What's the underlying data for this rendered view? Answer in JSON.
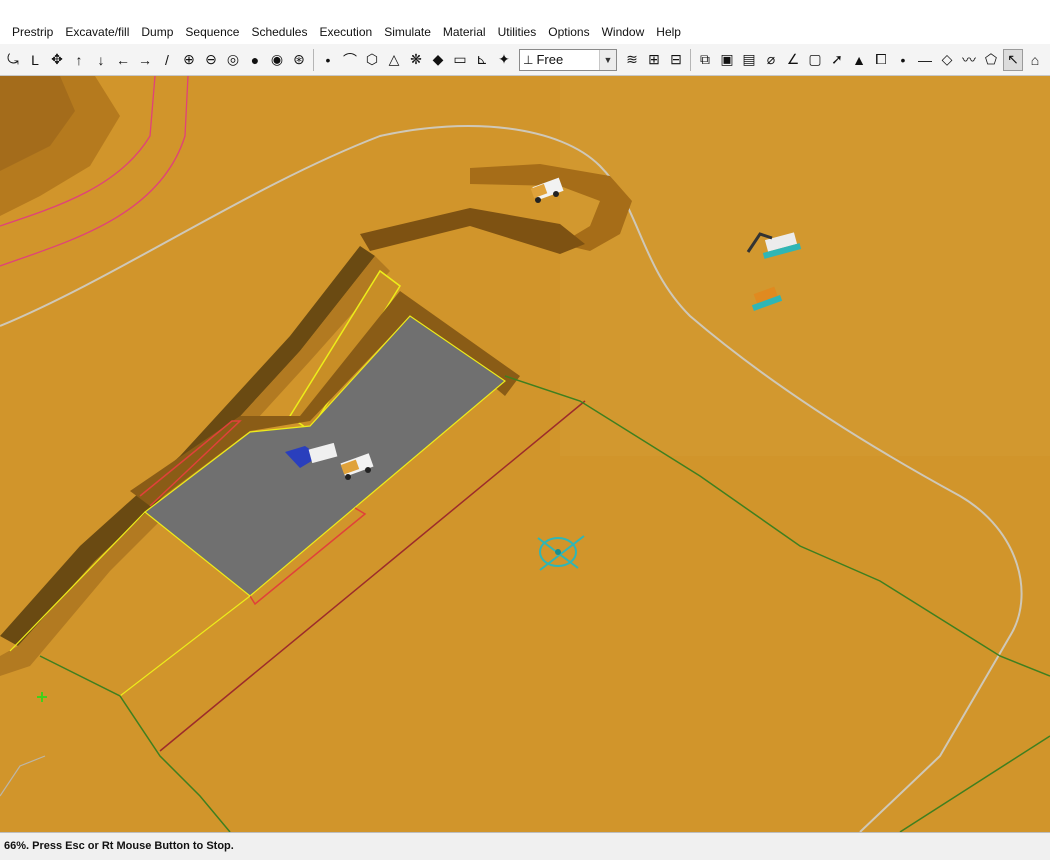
{
  "menu": [
    "Prestrip",
    "Excavate/fill",
    "Dump",
    "Sequence",
    "Schedules",
    "Execution",
    "Simulate",
    "Material",
    "Utilities",
    "Options",
    "Window",
    "Help"
  ],
  "toolbar": {
    "group1": [
      "⤿",
      "L",
      "✥",
      "↑",
      "↓",
      "←",
      "→",
      "/",
      "⊕",
      "⊖",
      "◎",
      "●",
      "◉",
      "⊛"
    ],
    "group1_names": [
      "rotate-icon",
      "axis-icon",
      "pan-icon",
      "move-up-icon",
      "move-down-icon",
      "move-left-icon",
      "move-right-icon",
      "draw-line-icon",
      "zoom-in-icon",
      "zoom-out-icon",
      "zoom-window-icon",
      "sphere-icon",
      "zoom-target-icon",
      "zoom-extents-icon"
    ],
    "group2": [
      "•",
      "⌒",
      "⬡",
      "△",
      "❋",
      "◆",
      "▭",
      "⊾",
      "✦"
    ],
    "group2_names": [
      "point-icon",
      "polyline-icon",
      "polygon-icon",
      "triangle-icon",
      "pattern-icon",
      "diamond-icon",
      "rectangle-icon",
      "profile-icon",
      "compass-icon"
    ],
    "view_mode": {
      "value": "Free",
      "icon": "⊥"
    },
    "group3": [
      "≋",
      "⊞",
      "⊟"
    ],
    "group3_names": [
      "layers-icon",
      "grid-icon",
      "surface-icon"
    ],
    "group4": [
      "⧉",
      "▣",
      "▤",
      "⌀",
      "∠",
      "▢",
      "➚",
      "▲",
      "⧠",
      "•",
      "—",
      "◇",
      "〰",
      "⬠",
      "↖",
      "⌂",
      "⌂",
      "✕"
    ],
    "group4_names": [
      "select-icon",
      "frame-icon",
      "block-icon",
      "measure-icon",
      "angle-icon",
      "box-icon",
      "arrow-icon",
      "terrain-icon",
      "clip-icon",
      "dot-icon",
      "line-icon",
      "diamond-outline-icon",
      "wave-icon",
      "pentagon-icon",
      "pointer-icon",
      "house-icon",
      "house-dots-icon",
      "close-icon"
    ]
  },
  "status": {
    "text": "66%. Press Esc or Rt Mouse Button to Stop."
  },
  "colors": {
    "terrain": "#d1952b",
    "pit_floor": "#6f6f6c",
    "road": "#c9c1ae",
    "boundary_yellow": "#eded1a",
    "boundary_red": "#e0413a",
    "boundary_green": "#3f7f1f",
    "cursor_cyan": "#2fb6b6"
  }
}
